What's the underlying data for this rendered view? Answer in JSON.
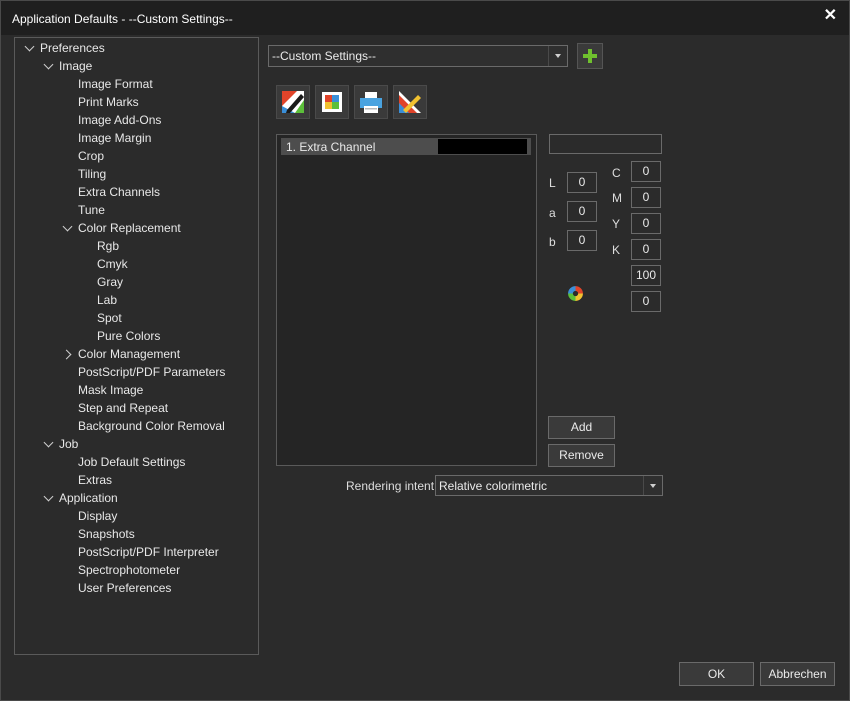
{
  "window": {
    "title": "Application Defaults - --Custom Settings--",
    "close_glyph": "✕"
  },
  "tree": [
    {
      "label": "Preferences",
      "arrow": "down"
    },
    {
      "label": "Image",
      "arrow": "down"
    },
    {
      "label": "Image Format",
      "arrow": ""
    },
    {
      "label": "Print Marks",
      "arrow": ""
    },
    {
      "label": "Image Add-Ons",
      "arrow": ""
    },
    {
      "label": "Image Margin",
      "arrow": ""
    },
    {
      "label": "Crop",
      "arrow": ""
    },
    {
      "label": "Tiling",
      "arrow": ""
    },
    {
      "label": "Extra Channels",
      "arrow": ""
    },
    {
      "label": "Tune",
      "arrow": ""
    },
    {
      "label": "Color Replacement",
      "arrow": "down"
    },
    {
      "label": "Rgb",
      "arrow": ""
    },
    {
      "label": "Cmyk",
      "arrow": ""
    },
    {
      "label": "Gray",
      "arrow": ""
    },
    {
      "label": "Lab",
      "arrow": ""
    },
    {
      "label": "Spot",
      "arrow": ""
    },
    {
      "label": "Pure Colors",
      "arrow": ""
    },
    {
      "label": "Color Management",
      "arrow": "right"
    },
    {
      "label": "PostScript/PDF Parameters",
      "arrow": ""
    },
    {
      "label": "Mask Image",
      "arrow": ""
    },
    {
      "label": "Step and Repeat",
      "arrow": ""
    },
    {
      "label": "Background Color Removal",
      "arrow": ""
    },
    {
      "label": "Job",
      "arrow": "down"
    },
    {
      "label": "Job Default Settings",
      "arrow": ""
    },
    {
      "label": "Extras",
      "arrow": ""
    },
    {
      "label": "Application",
      "arrow": "down"
    },
    {
      "label": "Display",
      "arrow": ""
    },
    {
      "label": "Snapshots",
      "arrow": ""
    },
    {
      "label": "PostScript/PDF Interpreter",
      "arrow": ""
    },
    {
      "label": "Spectrophotometer",
      "arrow": ""
    },
    {
      "label": "User Preferences",
      "arrow": ""
    }
  ],
  "settings_combo": {
    "value": "--Custom Settings--"
  },
  "toolbar": {
    "icons": [
      "edit-swatch-icon",
      "color-patches-icon",
      "printer-icon",
      "measure-ruler-icon"
    ]
  },
  "channels": [
    {
      "label": "1. Extra Channel",
      "swatch": "#000000"
    }
  ],
  "lab": {
    "L_label": "L",
    "L": "0",
    "a_label": "a",
    "a": "0",
    "b_label": "b",
    "b": "0"
  },
  "cmyk": {
    "C_label": "C",
    "C": "0",
    "M_label": "M",
    "M": "0",
    "Y_label": "Y",
    "Y": "0",
    "K_label": "K",
    "K": "0",
    "extra1": "100",
    "extra2": "0"
  },
  "buttons": {
    "add": "Add",
    "remove": "Remove",
    "ok": "OK",
    "cancel": "Abbrechen"
  },
  "rendering": {
    "label": "Rendering intent:",
    "value": "Relative colorimetric"
  },
  "colors": {
    "accent_green": "#6fc02e"
  }
}
